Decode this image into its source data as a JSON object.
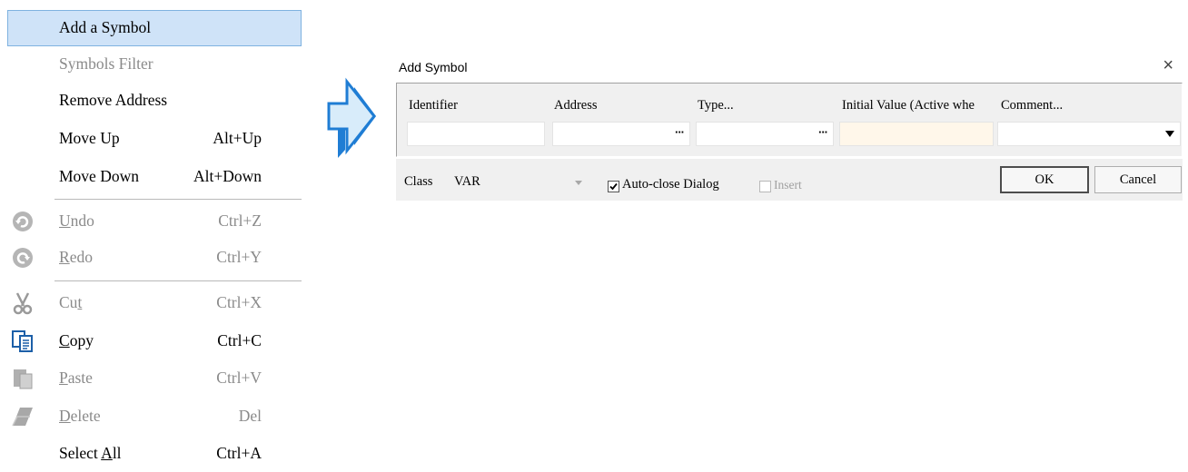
{
  "menu": {
    "items": [
      {
        "label": "Add a Symbol",
        "shortcut": "",
        "enabled": true,
        "highlighted": true
      },
      {
        "label": "Symbols Filter",
        "shortcut": "",
        "enabled": false
      },
      {
        "label": "Remove Address",
        "shortcut": "",
        "enabled": true
      },
      {
        "label": "Move Up",
        "shortcut": "Alt+Up",
        "enabled": true
      },
      {
        "label": "Move Down",
        "shortcut": "Alt+Down",
        "enabled": true
      },
      {
        "label": "ndo",
        "accel": "U",
        "shortcut": "Ctrl+Z",
        "enabled": false,
        "icon": "undo-icon"
      },
      {
        "label": "edo",
        "accel": "R",
        "shortcut": "Ctrl+Y",
        "enabled": false,
        "icon": "redo-icon"
      },
      {
        "label_pre": "Cu",
        "accel": "t",
        "shortcut": "Ctrl+X",
        "enabled": false,
        "icon": "scissors-icon"
      },
      {
        "label": "opy",
        "accel": "C",
        "shortcut": "Ctrl+C",
        "enabled": true,
        "icon": "copy-icon"
      },
      {
        "label": "aste",
        "accel": "P",
        "shortcut": "Ctrl+V",
        "enabled": false,
        "icon": "paste-icon"
      },
      {
        "label": "elete",
        "accel": "D",
        "shortcut": "Del",
        "enabled": false,
        "icon": "eraser-icon"
      },
      {
        "label_pre": "Select ",
        "accel": "A",
        "label": "ll",
        "shortcut": "Ctrl+A",
        "enabled": true
      }
    ]
  },
  "dialog": {
    "title": "Add Symbol",
    "close_glyph": "×",
    "columns": [
      "Identifier",
      "Address",
      "Type...",
      "Initial Value (Active whe",
      "Comment..."
    ],
    "fields": {
      "identifier": "",
      "address": "",
      "type": "",
      "initial_value": "",
      "comment": ""
    },
    "browse_glyph": "···",
    "class_label": "Class",
    "class_value": "VAR",
    "auto_close_label": "Auto-close Dialog",
    "auto_close_checked": true,
    "insert_label": "Insert",
    "insert_checked": false,
    "ok_label": "OK",
    "cancel_label": "Cancel"
  },
  "colors": {
    "highlight": "#cfe3f8",
    "arrow_fill": "#d8ecfa",
    "arrow_stroke": "#1f7dd4",
    "panel": "#f0f0f0"
  }
}
